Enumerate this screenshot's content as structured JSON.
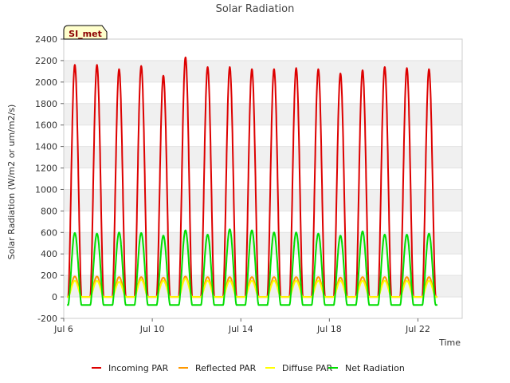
{
  "chart_data": {
    "type": "line",
    "title": "Solar Radiation",
    "xlabel": "Time",
    "ylabel": "Solar Radiation (W/m2 or um/m2/s)",
    "badge": "SI_met",
    "xlim": [
      6.0,
      24.0
    ],
    "ylim": [
      -200,
      2400
    ],
    "yticks": [
      -200,
      0,
      200,
      400,
      600,
      800,
      1000,
      1200,
      1400,
      1600,
      1800,
      2000,
      2200,
      2400
    ],
    "xticks": [
      {
        "value": 6,
        "label": "Jul 6"
      },
      {
        "value": 10,
        "label": "Jul 10"
      },
      {
        "value": 14,
        "label": "Jul 14"
      },
      {
        "value": 18,
        "label": "Jul 18"
      },
      {
        "value": 22,
        "label": "Jul 22"
      }
    ],
    "grid": true,
    "legend_position": "bottom",
    "days": [
      6.5,
      7.5,
      8.5,
      9.5,
      10.5,
      11.5,
      12.5,
      13.5,
      14.5,
      15.5,
      16.5,
      17.5,
      18.5,
      19.5,
      20.5,
      21.5,
      22.5
    ],
    "series": [
      {
        "name": "Incoming PAR",
        "color": "#dd0000",
        "daily_peak": [
          2160,
          2160,
          2120,
          2150,
          2060,
          2230,
          2140,
          2140,
          2120,
          2120,
          2130,
          2120,
          2080,
          2110,
          2140,
          2130,
          2120
        ],
        "baseline": 0
      },
      {
        "name": "Reflected PAR",
        "color": "#ff9900",
        "daily_peak": [
          190,
          190,
          185,
          185,
          180,
          190,
          185,
          185,
          185,
          185,
          185,
          185,
          180,
          185,
          185,
          185,
          185
        ],
        "baseline": 0
      },
      {
        "name": "Diffuse PAR",
        "color": "#ffff00",
        "daily_peak": [
          150,
          150,
          140,
          160,
          150,
          170,
          150,
          150,
          150,
          150,
          150,
          150,
          150,
          150,
          150,
          150,
          150
        ],
        "baseline": 0
      },
      {
        "name": "Net Radiation",
        "color": "#00dd00",
        "daily_peak": [
          595,
          590,
          600,
          595,
          570,
          620,
          580,
          630,
          620,
          600,
          600,
          590,
          570,
          610,
          580,
          580,
          590
        ],
        "baseline": -75
      }
    ]
  }
}
